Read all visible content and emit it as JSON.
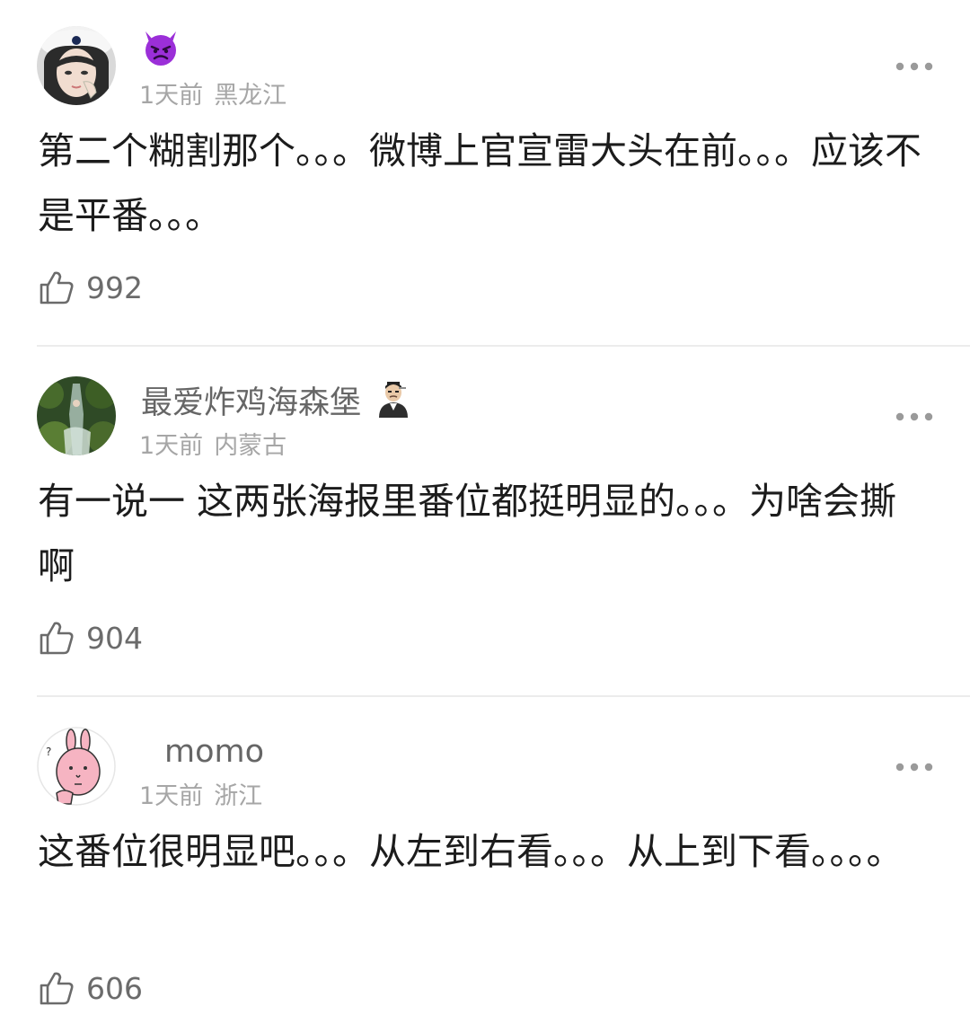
{
  "comments": [
    {
      "username": "",
      "badge_icon": "angry-devil-emoji-icon",
      "time": "1天前",
      "location": "黑龙江",
      "text": "第二个糊割那个。。。微博上官宣雷大头在前。。。应该不是平番。。。",
      "likes": "992",
      "avatar": "avatar-girl-hoodie"
    },
    {
      "username": "最爱炸鸡海森堡",
      "badge_icon": "man-in-suit-emoji-icon",
      "time": "1天前",
      "location": "内蒙古",
      "text": "有一说一 这两张海报里番位都挺明显的。。。为啥会撕啊",
      "likes": "904",
      "avatar": "avatar-nature-photo"
    },
    {
      "username": "momo",
      "badge_icon": "",
      "time": "1天前",
      "location": "浙江",
      "text": "这番位很明显吧。。。从左到右看。。。从上到下看。。。。",
      "likes": "606",
      "avatar": "avatar-pink-rabbit"
    }
  ],
  "colors": {
    "text": "#1c1c1c",
    "meta": "#a6a6a6",
    "username": "#666666",
    "divider": "#ececec",
    "devil_purple": "#9b2fd8"
  },
  "icons": {
    "like": "thumbs-up-outline-icon",
    "more": "more-dots-icon"
  }
}
